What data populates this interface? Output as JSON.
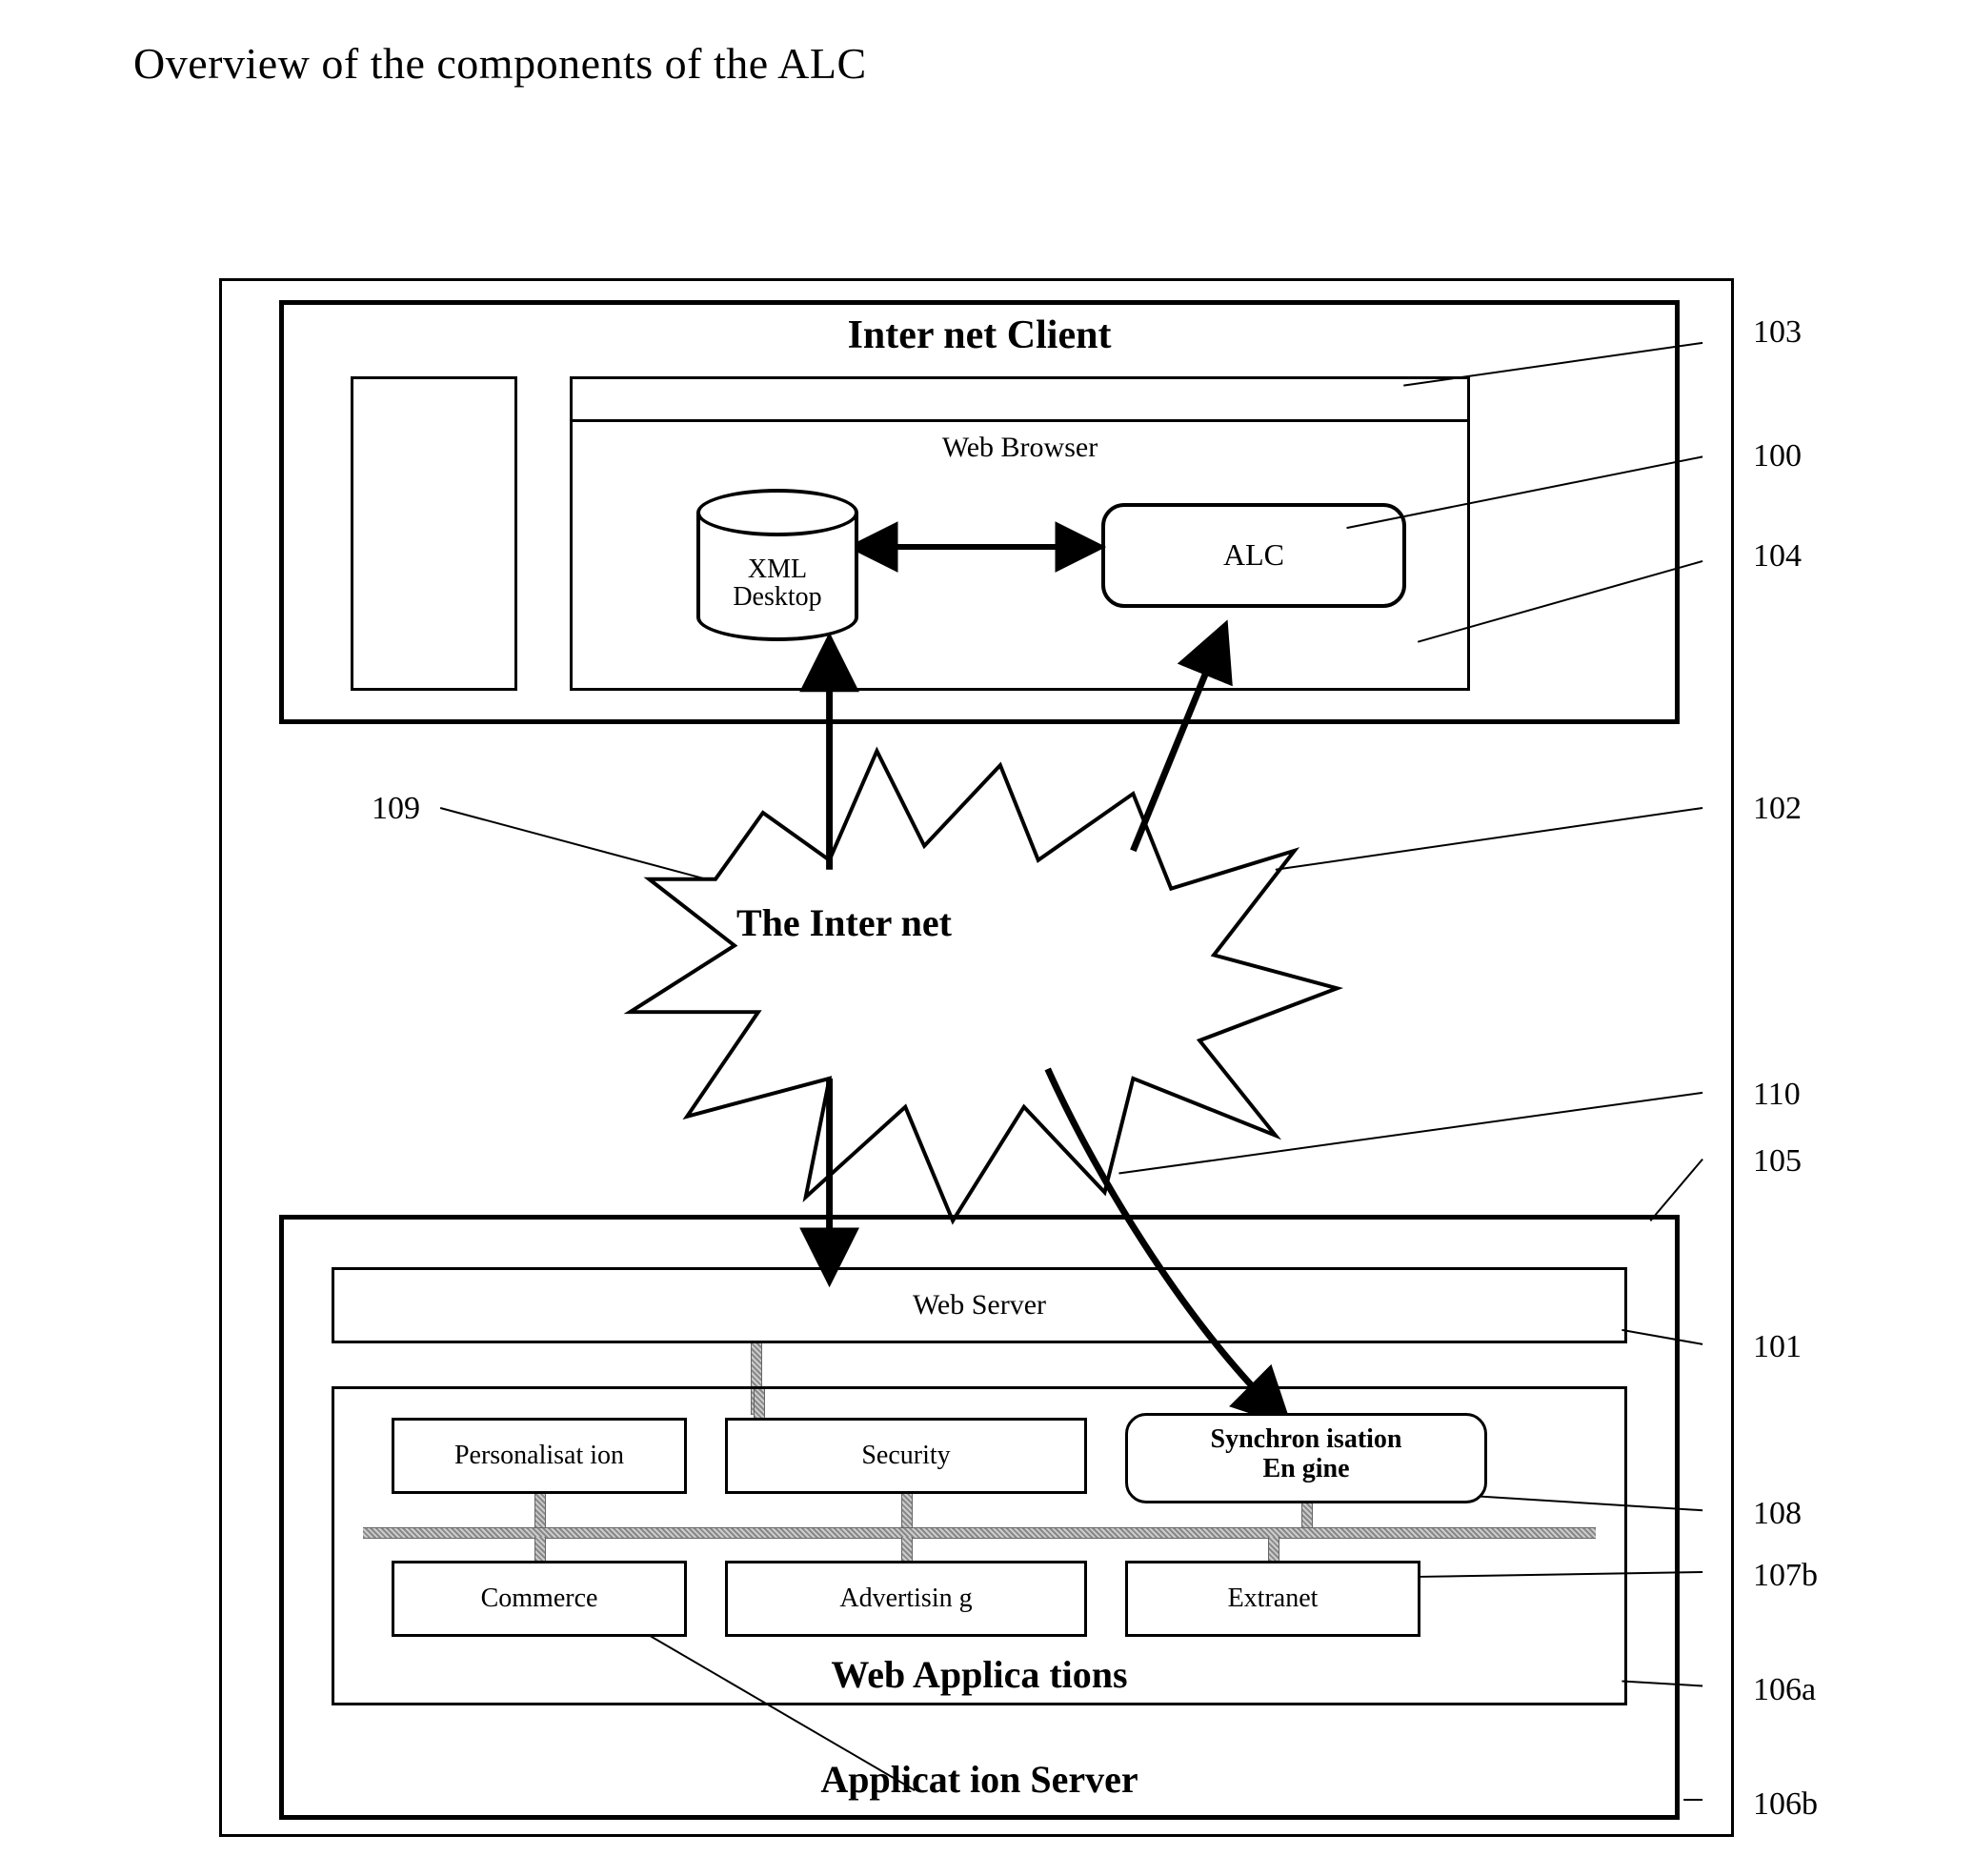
{
  "title": "Overview  of the components of the ALC",
  "client": {
    "heading": "Inter net Client",
    "browser_label": "Web Browser",
    "xml_desktop_l1": "XML",
    "xml_desktop_l2": "Desktop",
    "alc_label": "ALC"
  },
  "internet_label": "The Inter net",
  "server": {
    "webserver_label": "Web Server",
    "webapps_title": "Web Applica tions",
    "appserver_title": "Applicat ion Server",
    "modules": {
      "personalisation": "Personalisat ion",
      "security": "Security",
      "sync_l1": "Synchron isation",
      "sync_l2": "En gine",
      "commerce": "Commerce",
      "advertising": "Advertisin g",
      "extranet": "Extranet"
    }
  },
  "refs": {
    "r103": "103",
    "r100": "100",
    "r104": "104",
    "r109": "109",
    "r102": "102",
    "r110": "110",
    "r105": "105",
    "r101": "101",
    "r108": "108",
    "r107b": "107b",
    "r106a": "106a",
    "r106b": "106b"
  }
}
